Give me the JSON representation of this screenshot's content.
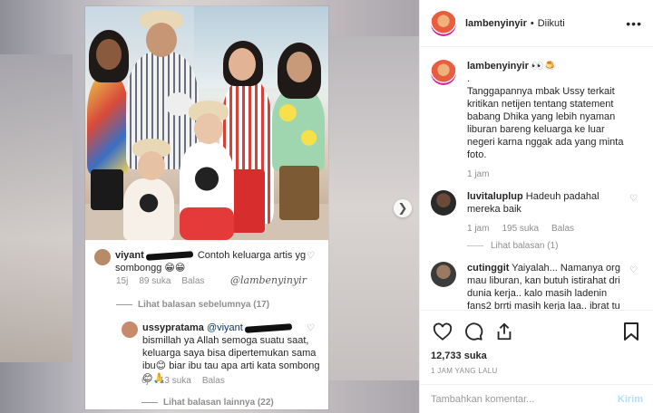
{
  "post": {
    "username": "lambenyinyir",
    "follow_status": "Diikuti",
    "more_icon": "more-horizontal-icon",
    "dot": "•"
  },
  "caption": {
    "username": "lambenyinyir",
    "emojis": "👀🍮",
    "line1": ".",
    "text": "Tanggapannya mbak Ussy terkait kritikan netijen tentang statement babang Dhika yang lebih nyaman liburan bareng keluarga ke luar negeri karna nggak ada yang minta foto.",
    "time": "1 jam"
  },
  "comments": [
    {
      "username": "luvitaluplup",
      "text": "Hadeuh padahal mereka baik",
      "time": "1 jam",
      "likes": "195 suka",
      "reply": "Balas",
      "view_replies": "Lihat balasan (1)"
    },
    {
      "username": "cutinggit",
      "text": "Yaiyalah... Namanya org mau liburan, kan butuh istirahat dri dunia kerja.. kalo masih ladenin fans2 brrti masih kerja laa.. ibrat tu kerja di"
    }
  ],
  "actions": {
    "likes": "12,733 suka",
    "timestamp": "1 JAM YANG LALU"
  },
  "add_comment": {
    "placeholder": "Tambahkan komentar...",
    "post_label": "Kirim"
  },
  "embedded": {
    "comment1_user": "viyant",
    "comment1_text": "Contoh keluarga artis yg sombongg 😁😁",
    "comment1_time": "15j",
    "comment1_likes": "89 suka",
    "comment1_reply": "Balas",
    "watermark": "@lambenyinyir",
    "view_previous": "Lihat balasan sebelumnya (17)",
    "comment2_user": "ussypratama",
    "comment2_mention": "@viyant",
    "comment2_text": "bismillah ya Allah semoga suatu saat, keluarga saya bisa dipertemukan sama ibu😊 biar ibu tau apa arti kata sombong😊🙏",
    "comment2_time": "6j",
    "comment2_likes": "13 suka",
    "comment2_reply": "Balas",
    "view_more": "Lihat balasan lainnya (22)"
  },
  "colors": {
    "accent_blue_disabled": "#b2dffc",
    "secondary_text": "#8e8e8e",
    "border": "#efefef"
  }
}
